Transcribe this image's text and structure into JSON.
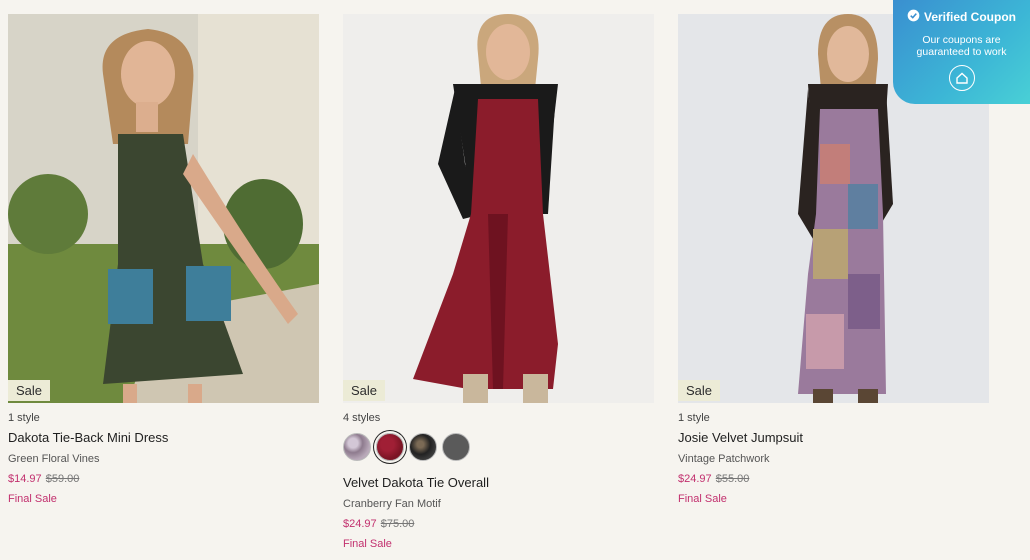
{
  "products": [
    {
      "badge": "Sale",
      "styles_label": "1 style",
      "name": "Dakota Tie-Back Mini Dress",
      "color": "Green Floral Vines",
      "price": "$14.97",
      "original_price": "$59.00",
      "final_label": "Final Sale"
    },
    {
      "badge": "Sale",
      "styles_label": "4 styles",
      "name": "Velvet Dakota Tie Overall",
      "color": "Cranberry Fan Motif",
      "price": "$24.97",
      "original_price": "$75.00",
      "final_label": "Final Sale",
      "swatches": [
        "grey-floral",
        "cranberry",
        "black-floral",
        "charcoal"
      ]
    },
    {
      "badge": "Sale",
      "styles_label": "1 style",
      "name": "Josie Velvet Jumpsuit",
      "color": "Vintage Patchwork",
      "price": "$24.97",
      "original_price": "$55.00",
      "final_label": "Final Sale"
    }
  ],
  "coupon": {
    "title": "Verified Coupon",
    "subtitle": "Our coupons are guaranteed to work",
    "icon": "home-icon"
  },
  "colors": {
    "sale_price": "#c2306e",
    "badge_bg": "#ecebd6",
    "coupon_gradient_start": "#3a8fd0",
    "coupon_gradient_end": "#49d0d6"
  }
}
